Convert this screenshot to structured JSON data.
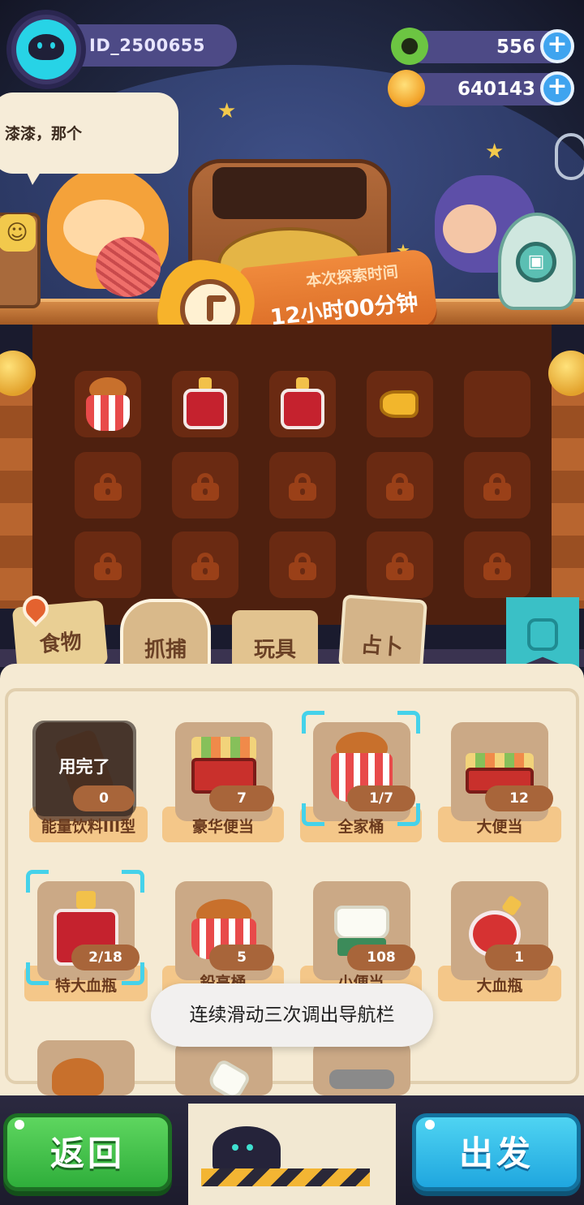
{
  "header": {
    "player_id": "ID_2500655",
    "currency_green": {
      "icon": "green-donut-coin-icon",
      "value": "556"
    },
    "currency_gold": {
      "icon": "gold-coin-icon",
      "value": "640143"
    }
  },
  "dialog": {
    "text": "漆漆，那个"
  },
  "expedition": {
    "label": "本次探索时间",
    "duration": "12小时00分钟"
  },
  "slots": {
    "row1": [
      {
        "item": "family-bucket",
        "icon": "fried-chicken-bucket-icon"
      },
      {
        "item": "red-potion",
        "icon": "red-potion-bottle-icon"
      },
      {
        "item": "red-potion",
        "icon": "red-potion-bottle-icon"
      },
      {
        "item": "horn",
        "icon": "horn-icon"
      },
      {
        "item": "empty",
        "icon": ""
      }
    ],
    "locked_rows": 2,
    "lock_icon": "lock-icon"
  },
  "tabs": [
    {
      "label": "食物",
      "active": false
    },
    {
      "label": "抓捕",
      "active": false
    },
    {
      "label": "玩具",
      "active": false
    },
    {
      "label": "占卜",
      "active": true
    }
  ],
  "inventory": {
    "used_up_label": "用完了",
    "items": [
      {
        "name": "能量饮料III型",
        "count": "0",
        "used_up": true,
        "icon": "energy-drink-icon"
      },
      {
        "name": "豪华便当",
        "count": "7",
        "icon": "deluxe-bento-icon"
      },
      {
        "name": "全家桶",
        "count": "1/7",
        "selected": true,
        "icon": "fried-chicken-bucket-icon"
      },
      {
        "name": "大便当",
        "count": "12",
        "icon": "big-bento-icon"
      },
      {
        "name": "特大血瓶",
        "count": "2/18",
        "selected": true,
        "icon": "huge-red-potion-icon"
      },
      {
        "name": "鉛高桶",
        "count": "5",
        "icon": "chicken-bucket-icon"
      },
      {
        "name": "小便当",
        "count": "108",
        "icon": "small-bento-icon"
      },
      {
        "name": "大血瓶",
        "count": "1",
        "icon": "big-red-potion-icon"
      }
    ]
  },
  "toast": {
    "text": "连续滑动三次调出导航栏"
  },
  "buttons": {
    "back": "返回",
    "go": "出发"
  },
  "colors": {
    "accent_green": "#2fae3b",
    "accent_blue": "#1fa6df",
    "panel_dark": "#4e200f",
    "inventory_bg": "#f5ead3"
  }
}
